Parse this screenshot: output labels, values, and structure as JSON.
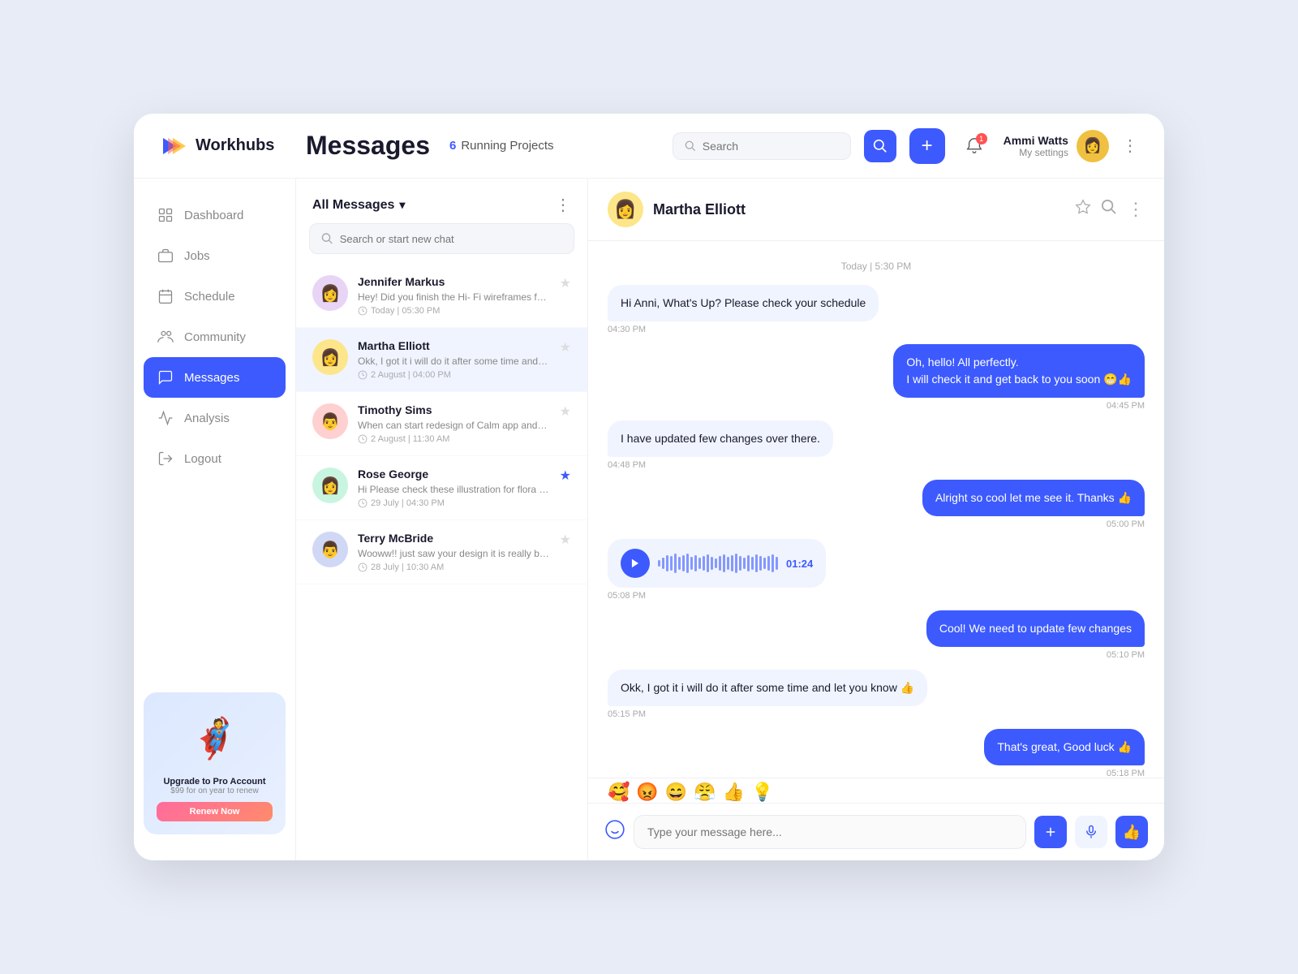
{
  "app": {
    "name": "Workhubs",
    "page_title": "Messages",
    "running_projects_count": "6",
    "running_projects_label": "Running Projects"
  },
  "topbar": {
    "search_placeholder": "Search",
    "add_btn_label": "+",
    "user": {
      "name": "Ammi Watts",
      "role": "My settings",
      "avatar_emoji": "👩"
    },
    "notifications_count": "1"
  },
  "sidebar": {
    "items": [
      {
        "id": "dashboard",
        "label": "Dashboard",
        "icon": "dashboard-icon"
      },
      {
        "id": "jobs",
        "label": "Jobs",
        "icon": "jobs-icon"
      },
      {
        "id": "schedule",
        "label": "Schedule",
        "icon": "schedule-icon"
      },
      {
        "id": "community",
        "label": "Community",
        "icon": "community-icon"
      },
      {
        "id": "messages",
        "label": "Messages",
        "icon": "messages-icon",
        "active": true
      },
      {
        "id": "analysis",
        "label": "Analysis",
        "icon": "analysis-icon"
      },
      {
        "id": "logout",
        "label": "Logout",
        "icon": "logout-icon"
      }
    ],
    "promo": {
      "title": "Upgrade to Pro Account",
      "subtitle": "$99 for on year to renew",
      "btn_label": "Renew Now"
    }
  },
  "chat_list": {
    "header": "All Messages",
    "search_placeholder": "Search or start new chat",
    "more_dots": "⋮",
    "items": [
      {
        "id": 1,
        "name": "Jennifer Markus",
        "preview": "Hey! Did you finish the Hi- Fi wireframes for flora app design?",
        "time": "Today | 05:30 PM",
        "avatar_emoji": "👩",
        "avatar_bg": "#e8d5f5",
        "starred": false
      },
      {
        "id": 2,
        "name": "Martha Elliott",
        "preview": "Okk, I got it i will do it after some time and let you know 👍",
        "time": "2 August | 04:00 PM",
        "avatar_emoji": "👩",
        "avatar_bg": "#fde68a",
        "starred": false,
        "selected": true
      },
      {
        "id": 3,
        "name": "Timothy Sims",
        "preview": "When can start redesign of Calm app and did you create a design system already?",
        "time": "2 August | 11:30 AM",
        "avatar_emoji": "👨",
        "avatar_bg": "#ffd0d0",
        "starred": false
      },
      {
        "id": 4,
        "name": "Rose George",
        "preview": "Hi Please check these illustration for flora app & Let me know your feedback.",
        "time": "29 July | 04:30 PM",
        "avatar_emoji": "👩",
        "avatar_bg": "#c8f5e0",
        "starred": true
      },
      {
        "id": 5,
        "name": "Terry McBride",
        "preview": "Wooww!! just saw your design it is really brilliantly designed. Good job man",
        "time": "28 July | 10:30 AM",
        "avatar_emoji": "👨",
        "avatar_bg": "#d0d8f5",
        "starred": false
      }
    ]
  },
  "chat": {
    "contact_name": "Martha Elliott",
    "contact_avatar_emoji": "👩",
    "contact_avatar_bg": "#fde68a",
    "date_divider": "Today | 5:30 PM",
    "messages": [
      {
        "id": 1,
        "type": "received",
        "text": "Hi Anni, What's Up? Please check your schedule",
        "time": "04:30 PM"
      },
      {
        "id": 2,
        "type": "sent",
        "text": "Oh, hello! All perfectly.\nI will check it and get back to you soon 😁👍",
        "time": "04:45 PM"
      },
      {
        "id": 3,
        "type": "received",
        "text": "I have updated few changes over there.",
        "time": "04:48 PM"
      },
      {
        "id": 4,
        "type": "sent",
        "text": "Alright so cool let me see it. Thanks 👍",
        "time": "05:00 PM"
      },
      {
        "id": 5,
        "type": "audio",
        "duration": "01:24",
        "time": "05:08 PM"
      },
      {
        "id": 6,
        "type": "sent",
        "text": "Cool! We need to update few changes",
        "time": "05:10 PM"
      },
      {
        "id": 7,
        "type": "received",
        "text": "Okk, I got it i will do it after some time and let you know 👍",
        "time": "05:15 PM"
      },
      {
        "id": 8,
        "type": "sent",
        "text": "That's great, Good luck 👍",
        "time": "05:18 PM"
      }
    ],
    "emoji_reactions": [
      "🥰",
      "😡",
      "😄",
      "😤",
      "👍",
      "💡"
    ],
    "input_placeholder": "Type your message here...",
    "send_icon": "👍"
  }
}
